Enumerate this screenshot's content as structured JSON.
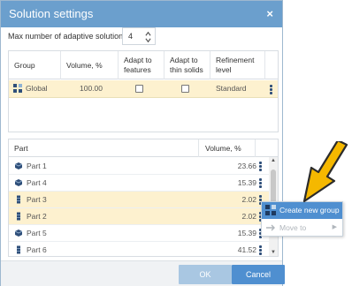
{
  "dialog": {
    "title": "Solution settings",
    "close_glyph": "×",
    "max_label": "Max number of adaptive solutions:",
    "max_value": "4"
  },
  "group_table": {
    "headers": {
      "group": "Group",
      "volume": "Volume, %",
      "adapt_features_1": "Adapt to",
      "adapt_features_2": "features",
      "adapt_thin_1": "Adapt to",
      "adapt_thin_2": "thin solids",
      "refinement_1": "Refinement",
      "refinement_2": "level"
    },
    "row": {
      "name": "Global",
      "volume": "100.00",
      "refinement": "Standard",
      "icon": "group-icon"
    }
  },
  "part_table": {
    "headers": {
      "part": "Part",
      "volume": "Volume, %"
    },
    "rows": [
      {
        "name": "Part 1",
        "volume": "23.66",
        "selected": false,
        "icon": "solid-part-icon"
      },
      {
        "name": "Part 4",
        "volume": "15.39",
        "selected": false,
        "icon": "solid-part-icon"
      },
      {
        "name": "Part 3",
        "volume": "2.02",
        "selected": true,
        "icon": "thin-part-icon"
      },
      {
        "name": "Part 2",
        "volume": "2.02",
        "selected": true,
        "icon": "thin-part-icon"
      },
      {
        "name": "Part 5",
        "volume": "15.39",
        "selected": false,
        "icon": "solid-part-icon"
      },
      {
        "name": "Part 6",
        "volume": "41.52",
        "selected": false,
        "icon": "thin-part-icon"
      }
    ]
  },
  "context_menu": {
    "create_group": "Create new group",
    "move_to": "Move to"
  },
  "footer": {
    "ok": "OK",
    "cancel": "Cancel"
  },
  "colors": {
    "titlebar": "#6b9fcd",
    "selected_row": "#fdf1cf",
    "primary_button": "#4f8fd0",
    "disabled_button": "#a9c7e2",
    "annotation_arrow": "#f5b800"
  }
}
